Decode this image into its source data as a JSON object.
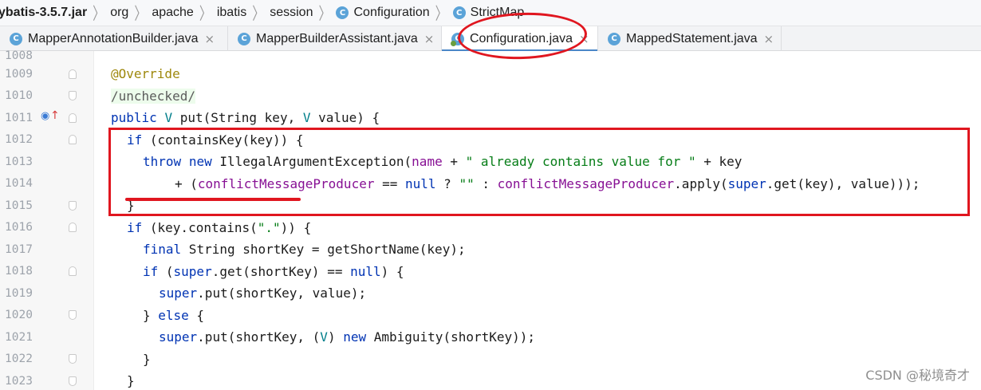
{
  "breadcrumb": {
    "jar": "ybatis-3.5.7.jar",
    "items": [
      "org",
      "apache",
      "ibatis",
      "session"
    ],
    "class1": "Configuration",
    "class2": "StrictMap"
  },
  "tabs": [
    {
      "label": "MapperAnnotationBuilder.java",
      "active": false
    },
    {
      "label": "MapperBuilderAssistant.java",
      "active": false
    },
    {
      "label": "Configuration.java",
      "active": true
    },
    {
      "label": "MappedStatement.java",
      "active": false
    }
  ],
  "close_glyph": "×",
  "class_icon_letter": "C",
  "editor": {
    "partial_line_number": "1008",
    "lines": [
      {
        "num": "1009"
      },
      {
        "num": "1010"
      },
      {
        "num": "1011"
      },
      {
        "num": "1012"
      },
      {
        "num": "1013"
      },
      {
        "num": "1014"
      },
      {
        "num": "1015"
      },
      {
        "num": "1016"
      },
      {
        "num": "1017"
      },
      {
        "num": "1018"
      },
      {
        "num": "1019"
      },
      {
        "num": "1020"
      },
      {
        "num": "1021"
      },
      {
        "num": "1022"
      },
      {
        "num": "1023"
      }
    ],
    "code": {
      "l1009": "@Override",
      "l1010": "/unchecked/",
      "l1011": {
        "kw1": "public",
        "typ": "V",
        "rest1": " put(String key, ",
        "typ2": "V",
        "rest2": " value) {"
      },
      "l1012": {
        "kw": "if",
        "rest": " (containsKey(key)) {"
      },
      "l1013": {
        "kw1": "throw",
        "kw2": "new",
        "mid": " IllegalArgumentException(",
        "fld": "name",
        "plus": " + ",
        "str": "\" already contains value for \"",
        "tail": " + key"
      },
      "l1014": {
        "pre": "+ (",
        "fld1": "conflictMessageProducer",
        "eq": " == ",
        "kw1": "null",
        "q": " ? ",
        "str": "\"\"",
        "colon": " : ",
        "fld2": "conflictMessageProducer",
        "apply": ".apply(",
        "kw2": "super",
        "tail": ".get(key), value)));"
      },
      "l1015": "}",
      "l1016": {
        "kw": "if",
        "a": " (key.contains(",
        "str": "\".\"",
        "b": ")) {"
      },
      "l1017": {
        "kw": "final",
        "rest": " String shortKey = getShortName(key);"
      },
      "l1018": {
        "kw1": "if",
        "a": " (",
        "kw2": "super",
        "b": ".get(shortKey) == ",
        "kw3": "null",
        "c": ") {"
      },
      "l1019": {
        "kw": "super",
        "rest": ".put(shortKey, value);"
      },
      "l1020": {
        "a": "} ",
        "kw": "else",
        "b": " {"
      },
      "l1021": {
        "kw1": "super",
        "a": ".put(shortKey, (",
        "typ": "V",
        "b": ") ",
        "kw2": "new",
        "c": " Ambiguity(shortKey));"
      },
      "l1022": "}",
      "l1023": "}"
    }
  },
  "gutter_icons": {
    "override": "override-marker-icon",
    "up": "implements-up-arrow-icon"
  },
  "colors": {
    "keyword": "#0033b3",
    "annotation": "#9e880d",
    "string": "#067d17",
    "field": "#871094",
    "highlight": "#e0161f"
  },
  "watermark": "CSDN @秘境奇才"
}
